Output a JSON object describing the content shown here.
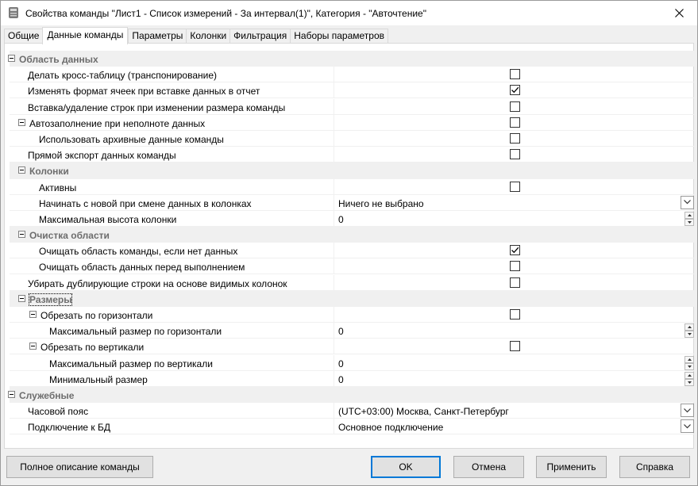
{
  "window": {
    "title": "Свойства команды \"Лист1 - Список измерений  - За интервал(1)\", Категория - \"Авточтение\""
  },
  "tabs": [
    {
      "label": "Общие",
      "active": false
    },
    {
      "label": "Данные команды",
      "active": true
    },
    {
      "label": "Параметры",
      "active": false
    },
    {
      "label": "Колонки",
      "active": false
    },
    {
      "label": "Фильтрация",
      "active": false
    },
    {
      "label": "Наборы параметров",
      "active": false
    }
  ],
  "rows": [
    {
      "type": "category",
      "label": "Область данных",
      "level": 0,
      "toggle": true
    },
    {
      "type": "check",
      "label": "Делать кросс-таблицу (транспонирование)",
      "level": 1,
      "checked": false
    },
    {
      "type": "check",
      "label": "Изменять формат ячеек при вставке данных в отчет",
      "level": 1,
      "checked": true
    },
    {
      "type": "check",
      "label": "Вставка/удаление строк при изменении размера команды",
      "level": 1,
      "checked": false
    },
    {
      "type": "check",
      "label": "Автозаполнение при неполноте данных",
      "level": 1,
      "checked": false,
      "toggle": true
    },
    {
      "type": "check",
      "label": "Использовать архивные данные команды",
      "level": 2,
      "checked": false
    },
    {
      "type": "check",
      "label": "Прямой экспорт данных команды",
      "level": 1,
      "checked": false
    },
    {
      "type": "category",
      "label": "Колонки",
      "level": 1,
      "toggle": true
    },
    {
      "type": "check",
      "label": "Активны",
      "level": 2,
      "checked": false
    },
    {
      "type": "dropdown",
      "label": "Начинать с новой при смене данных в колонках",
      "level": 2,
      "value": "Ничего не выбрано"
    },
    {
      "type": "spin",
      "label": "Максимальная высота колонки",
      "level": 2,
      "value": "0"
    },
    {
      "type": "category",
      "label": "Очистка области",
      "level": 1,
      "toggle": true
    },
    {
      "type": "check",
      "label": "Очищать область команды, если нет данных",
      "level": 2,
      "checked": true
    },
    {
      "type": "check",
      "label": "Очищать область данных перед выполнением",
      "level": 2,
      "checked": false
    },
    {
      "type": "check",
      "label": "Убирать дублирующие строки на основе видимых колонок",
      "level": 1,
      "checked": false
    },
    {
      "type": "category",
      "label": "Размеры",
      "level": 1,
      "toggle": true,
      "focused": true
    },
    {
      "type": "check",
      "label": "Обрезать по горизонтали",
      "level": 2,
      "checked": false,
      "toggle": true
    },
    {
      "type": "spin",
      "label": "Максимальный размер по горизонтали",
      "level": 3,
      "value": "0"
    },
    {
      "type": "check",
      "label": "Обрезать по вертикали",
      "level": 2,
      "checked": false,
      "toggle": true
    },
    {
      "type": "spin",
      "label": "Максимальный размер по вертикали",
      "level": 3,
      "value": "0"
    },
    {
      "type": "spin",
      "label": "Минимальный размер",
      "level": 3,
      "value": "0"
    },
    {
      "type": "category",
      "label": "Служебные",
      "level": 0,
      "toggle": true
    },
    {
      "type": "dropdown",
      "label": "Часовой пояс",
      "level": 1,
      "value": "(UTC+03:00) Москва, Санкт-Петербург"
    },
    {
      "type": "dropdown",
      "label": "Подключение к БД",
      "level": 1,
      "value": "Основное подключение"
    }
  ],
  "buttons": {
    "full_description": "Полное описание команды",
    "ok": "OK",
    "cancel": "Отмена",
    "apply": "Применить",
    "help": "Справка"
  },
  "colors": {
    "category_bg": "#f0f0f0",
    "default_button_border": "#0078d7"
  }
}
